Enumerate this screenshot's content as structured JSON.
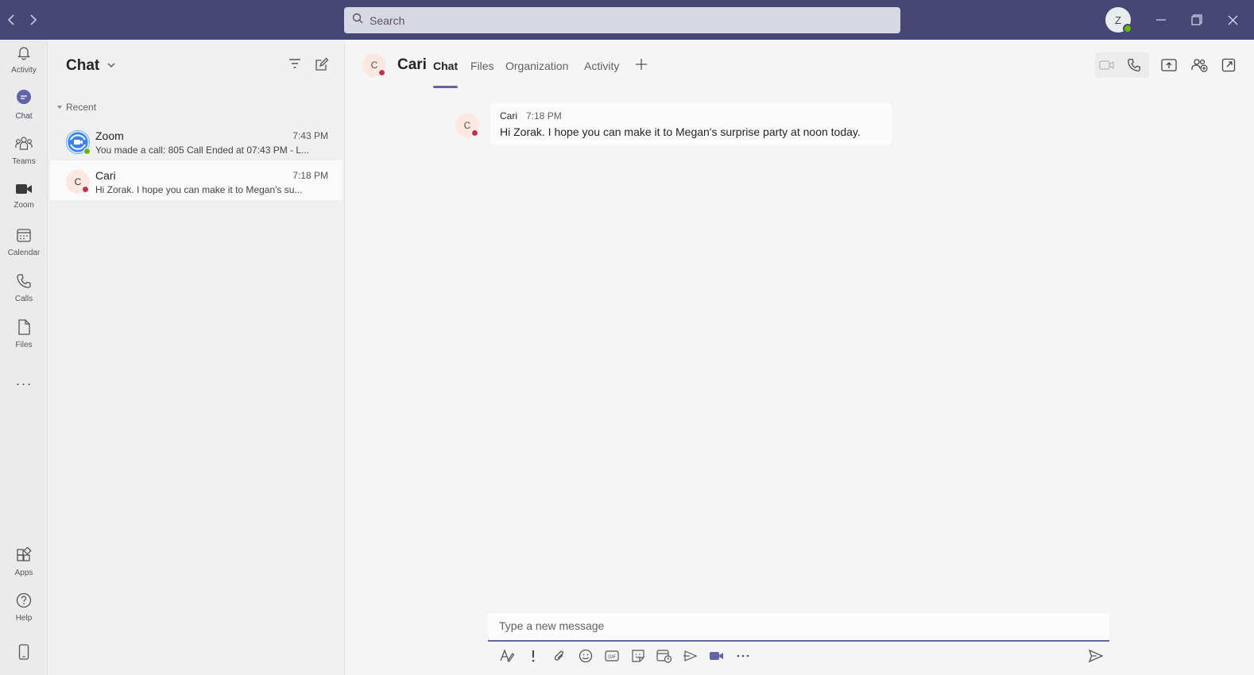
{
  "titlebar": {
    "search_placeholder": "Search",
    "user_initial": "Z"
  },
  "rail": {
    "items": [
      {
        "label": "Activity"
      },
      {
        "label": "Chat"
      },
      {
        "label": "Teams"
      },
      {
        "label": "Zoom"
      },
      {
        "label": "Calendar"
      },
      {
        "label": "Calls"
      },
      {
        "label": "Files"
      }
    ],
    "more": "···",
    "bottom": [
      {
        "label": "Apps"
      },
      {
        "label": "Help"
      }
    ]
  },
  "chat_list": {
    "title": "Chat",
    "section": "Recent",
    "items": [
      {
        "name": "Zoom",
        "time": "7:43 PM",
        "preview": "You made a call: 805 Call Ended at 07:43 PM - L..."
      },
      {
        "name": "Cari",
        "initial": "C",
        "time": "7:18 PM",
        "preview": "Hi Zorak. I hope you can make it to Megan's su..."
      }
    ]
  },
  "conversation": {
    "contact_initial": "C",
    "contact_name": "Cari",
    "tabs": [
      "Chat",
      "Files",
      "Organization",
      "Activity"
    ],
    "active_tab": "Chat",
    "messages": [
      {
        "author": "Cari",
        "initial": "C",
        "time": "7:18 PM",
        "text": "Hi Zorak. I hope you can make it to Megan's surprise party at noon today."
      }
    ],
    "composer_placeholder": "Type a new message"
  },
  "colors": {
    "titlebar": "#464775",
    "accent": "#6264a7",
    "busy": "#c4314b",
    "available": "#6bb700"
  }
}
